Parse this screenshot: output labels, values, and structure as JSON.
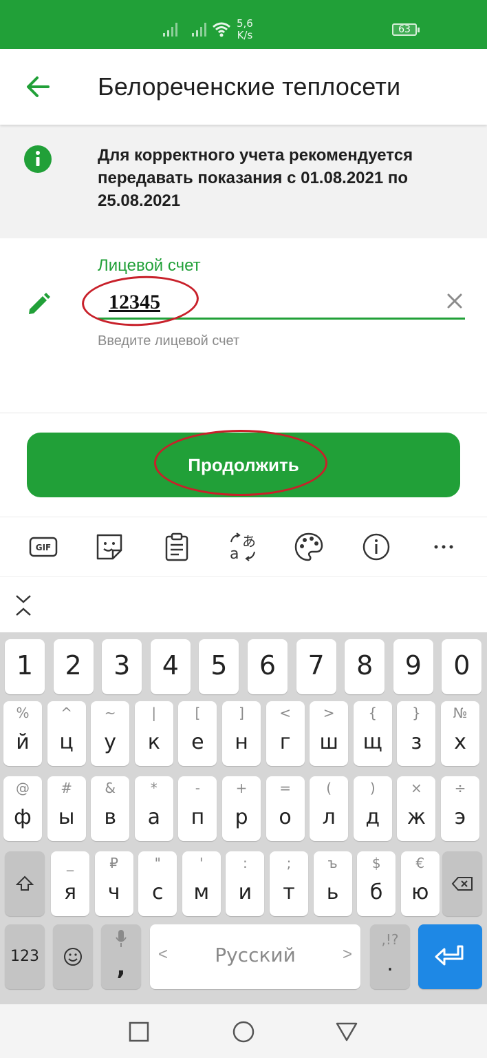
{
  "status_bar": {
    "speed_value": "5,6",
    "speed_unit": "K/s",
    "battery": "63",
    "background": "#21a038"
  },
  "app_bar": {
    "title": "Белореченские теплосети",
    "back_icon": "arrow-left-icon"
  },
  "notice": {
    "icon": "info-icon",
    "text": "Для корректного учета рекомендуется передавать показания с 01.08.2021 по 25.08.2021"
  },
  "form": {
    "label": "Лицевой счет",
    "value": "12345",
    "hint": "Введите лицевой счет",
    "edit_icon": "pencil-icon",
    "clear_icon": "close-icon"
  },
  "continue_button": {
    "label": "Продолжить"
  },
  "colors": {
    "accent": "#21a038",
    "annotation": "#c8202a",
    "enter_key": "#1e88e5"
  },
  "keyboard": {
    "toolbar": [
      {
        "name": "gif-icon",
        "label": "GIF"
      },
      {
        "name": "sticker-icon"
      },
      {
        "name": "clipboard-icon"
      },
      {
        "name": "translate-icon"
      },
      {
        "name": "palette-icon"
      },
      {
        "name": "info-circle-icon"
      },
      {
        "name": "more-icon"
      }
    ],
    "numbers": [
      "1",
      "2",
      "3",
      "4",
      "5",
      "6",
      "7",
      "8",
      "9",
      "0"
    ],
    "row1": [
      {
        "main": "й",
        "sub": "%"
      },
      {
        "main": "ц",
        "sub": "^"
      },
      {
        "main": "у",
        "sub": "~"
      },
      {
        "main": "к",
        "sub": "|"
      },
      {
        "main": "е",
        "sub": "["
      },
      {
        "main": "н",
        "sub": "]"
      },
      {
        "main": "г",
        "sub": "<"
      },
      {
        "main": "ш",
        "sub": ">"
      },
      {
        "main": "щ",
        "sub": "{"
      },
      {
        "main": "з",
        "sub": "}"
      },
      {
        "main": "х",
        "sub": "№"
      }
    ],
    "row2": [
      {
        "main": "ф",
        "sub": "@"
      },
      {
        "main": "ы",
        "sub": "#"
      },
      {
        "main": "в",
        "sub": "&"
      },
      {
        "main": "а",
        "sub": "*"
      },
      {
        "main": "п",
        "sub": "-"
      },
      {
        "main": "р",
        "sub": "+"
      },
      {
        "main": "о",
        "sub": "="
      },
      {
        "main": "л",
        "sub": "("
      },
      {
        "main": "д",
        "sub": ")"
      },
      {
        "main": "ж",
        "sub": "×"
      },
      {
        "main": "э",
        "sub": "÷"
      }
    ],
    "row3": [
      {
        "main": "я",
        "sub": "_"
      },
      {
        "main": "ч",
        "sub": "₽"
      },
      {
        "main": "с",
        "sub": "\""
      },
      {
        "main": "м",
        "sub": "'"
      },
      {
        "main": "и",
        "sub": ":"
      },
      {
        "main": "т",
        "sub": ";"
      },
      {
        "main": "ь",
        "sub": "ъ"
      },
      {
        "main": "б",
        "sub": "$"
      },
      {
        "main": "ю",
        "sub": "€"
      }
    ],
    "num_switch": "123",
    "comma": ",",
    "space_label": "Русский",
    "space_left": "<",
    "space_right": ">",
    "punct_sub": ",!?",
    "punct_main": "."
  }
}
